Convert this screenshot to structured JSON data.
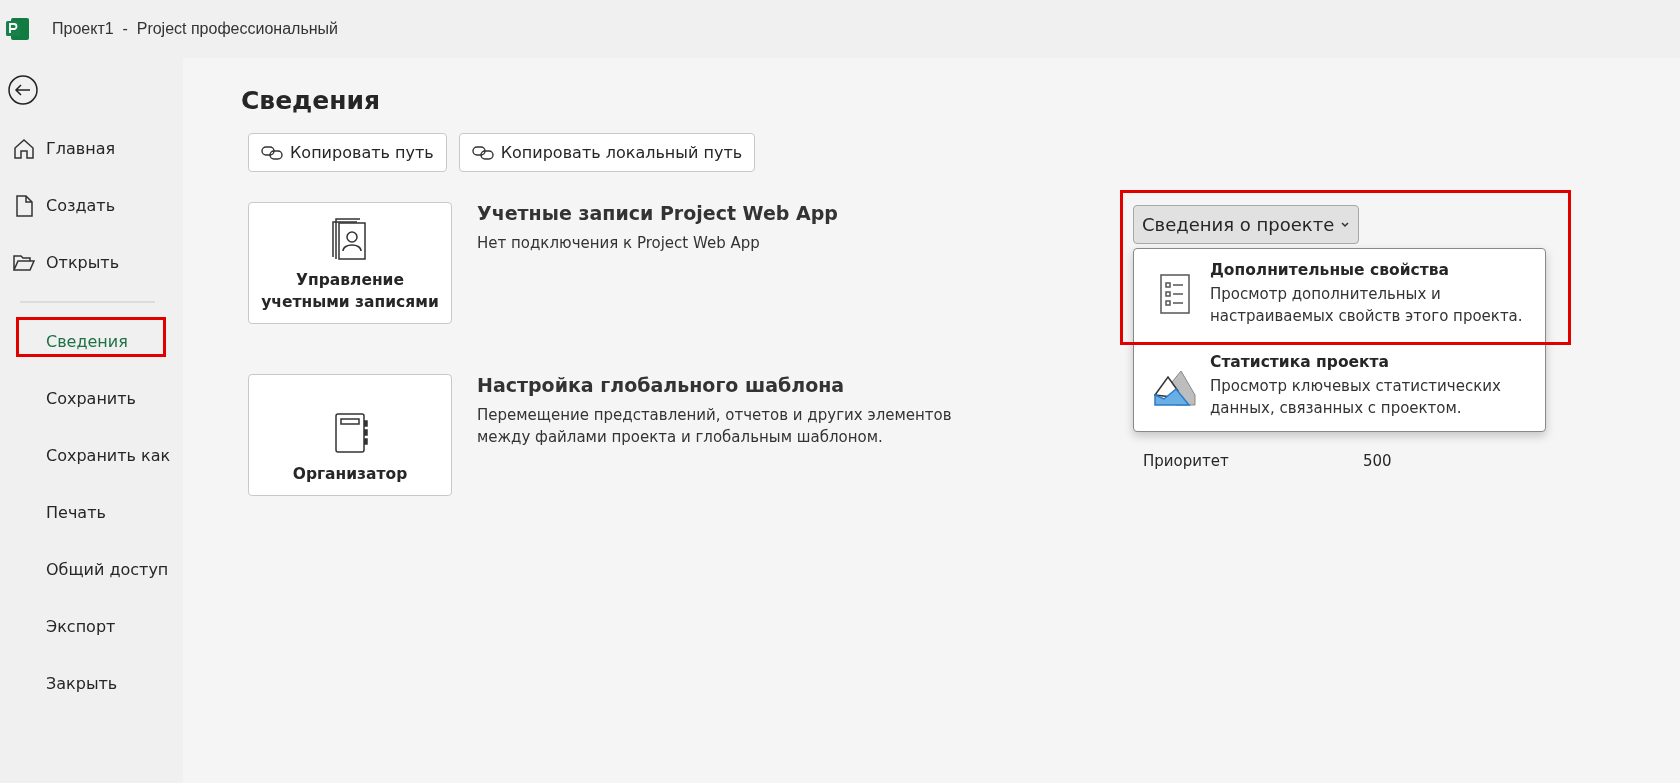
{
  "window": {
    "title": "Проект1  -  Project профессиональный"
  },
  "sidebar": {
    "items": [
      {
        "label": "Главная",
        "kind": "home",
        "selected": false,
        "highlighted": false
      },
      {
        "label": "Создать",
        "kind": "new",
        "selected": false,
        "highlighted": false
      },
      {
        "label": "Открыть",
        "kind": "open",
        "selected": false,
        "highlighted": false
      },
      {
        "label": "Сведения",
        "kind": "plain",
        "selected": true,
        "highlighted": true
      },
      {
        "label": "Сохранить",
        "kind": "plain",
        "selected": false,
        "highlighted": false
      },
      {
        "label": "Сохранить как",
        "kind": "plain",
        "selected": false,
        "highlighted": false
      },
      {
        "label": "Печать",
        "kind": "plain",
        "selected": false,
        "highlighted": false
      },
      {
        "label": "Общий доступ",
        "kind": "plain",
        "selected": false,
        "highlighted": false
      },
      {
        "label": "Экспорт",
        "kind": "plain",
        "selected": false,
        "highlighted": false
      },
      {
        "label": "Закрыть",
        "kind": "plain",
        "selected": false,
        "highlighted": false
      }
    ]
  },
  "page": {
    "title": "Сведения",
    "path_buttons": [
      "Копировать путь",
      "Копировать локальный путь"
    ],
    "sections": [
      {
        "kind": "accounts",
        "button": [
          "Управление",
          "учетными записями"
        ],
        "title": "Учетные записи Project Web App",
        "description": "Нет подключения к Project Web App"
      },
      {
        "kind": "organizer",
        "button": [
          "Организатор"
        ],
        "title": "Настройка глобального шаблона",
        "description": "Перемещение представлений, отчетов и других элементов между файлами проекта и глобальным шаблоном."
      }
    ]
  },
  "project_info": {
    "dropdown": "Сведения о проекте",
    "expanded": true,
    "highlighted": true,
    "menu": [
      {
        "kind": "properties",
        "title": "Дополнительные свойства",
        "description": "Просмотр дополнительных и настраиваемых свойств этого проекта."
      },
      {
        "kind": "statistics",
        "title": "Статистика проекта",
        "description": "Просмотр ключевых статистических данных, связанных с проектом."
      }
    ],
    "properties": [
      {
        "label": "Приоритет",
        "value": "500"
      }
    ]
  }
}
